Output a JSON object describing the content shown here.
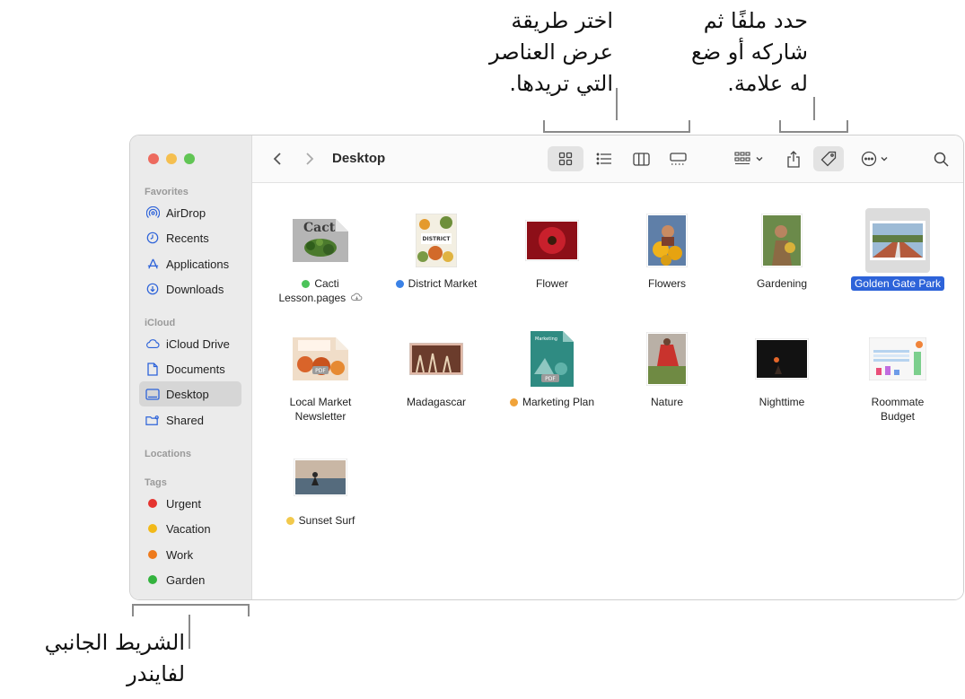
{
  "callouts": {
    "view_lines": [
      "اختر طريقة",
      "عرض العناصر",
      "التي تريدها."
    ],
    "tag_lines": [
      "حدد ملفًا ثم",
      "شاركه أو ضع",
      "له علامة."
    ],
    "sidebar_lines": [
      "الشريط الجانبي",
      "لفايندر"
    ]
  },
  "window": {
    "title": "Desktop"
  },
  "sidebar": {
    "favorites_header": "Favorites",
    "favorites": [
      {
        "label": "AirDrop",
        "icon": "airdrop-icon"
      },
      {
        "label": "Recents",
        "icon": "clock-icon"
      },
      {
        "label": "Applications",
        "icon": "applications-icon"
      },
      {
        "label": "Downloads",
        "icon": "download-icon"
      }
    ],
    "icloud_header": "iCloud",
    "icloud": [
      {
        "label": "iCloud Drive",
        "icon": "cloud-icon"
      },
      {
        "label": "Documents",
        "icon": "document-icon"
      },
      {
        "label": "Desktop",
        "icon": "desktop-icon"
      },
      {
        "label": "Shared",
        "icon": "shared-folder-icon"
      }
    ],
    "locations_header": "Locations",
    "tags_header": "Tags",
    "tags": [
      {
        "label": "Urgent",
        "color": "#e5332f"
      },
      {
        "label": "Vacation",
        "color": "#f2b919"
      },
      {
        "label": "Work",
        "color": "#ee7a1c"
      },
      {
        "label": "Garden",
        "color": "#33b33e"
      }
    ]
  },
  "colors": {
    "selection": "#2d63d9",
    "sidebar_active": "#d6d6d6"
  },
  "files": [
    {
      "name1": "Cacti",
      "name2": "Lesson.pages",
      "tag": "#4cc35a",
      "kind": "pages"
    },
    {
      "name1": "District Market",
      "name2": "",
      "tag": "#3b82e6",
      "kind": "poster"
    },
    {
      "name1": "Flower",
      "name2": "",
      "tag": "",
      "kind": "flower"
    },
    {
      "name1": "Flowers",
      "name2": "",
      "tag": "",
      "kind": "flowers"
    },
    {
      "name1": "Gardening",
      "name2": "",
      "tag": "",
      "kind": "gardening"
    },
    {
      "name1": "Golden Gate Park",
      "name2": "",
      "tag": "",
      "kind": "park",
      "selected": true
    },
    {
      "name1": "Local Market",
      "name2": "Newsletter",
      "tag": "",
      "kind": "pdf-orange"
    },
    {
      "name1": "Madagascar",
      "name2": "",
      "tag": "",
      "kind": "madagascar"
    },
    {
      "name1": "Marketing Plan",
      "name2": "",
      "tag": "#f0a33a",
      "kind": "pdf-teal"
    },
    {
      "name1": "Nature",
      "name2": "",
      "tag": "",
      "kind": "nature"
    },
    {
      "name1": "Nighttime",
      "name2": "",
      "tag": "",
      "kind": "night"
    },
    {
      "name1": "Roommate",
      "name2": "Budget",
      "tag": "",
      "kind": "sheet"
    },
    {
      "name1": "Sunset Surf",
      "name2": "",
      "tag": "#f2c94c",
      "kind": "surf"
    }
  ]
}
